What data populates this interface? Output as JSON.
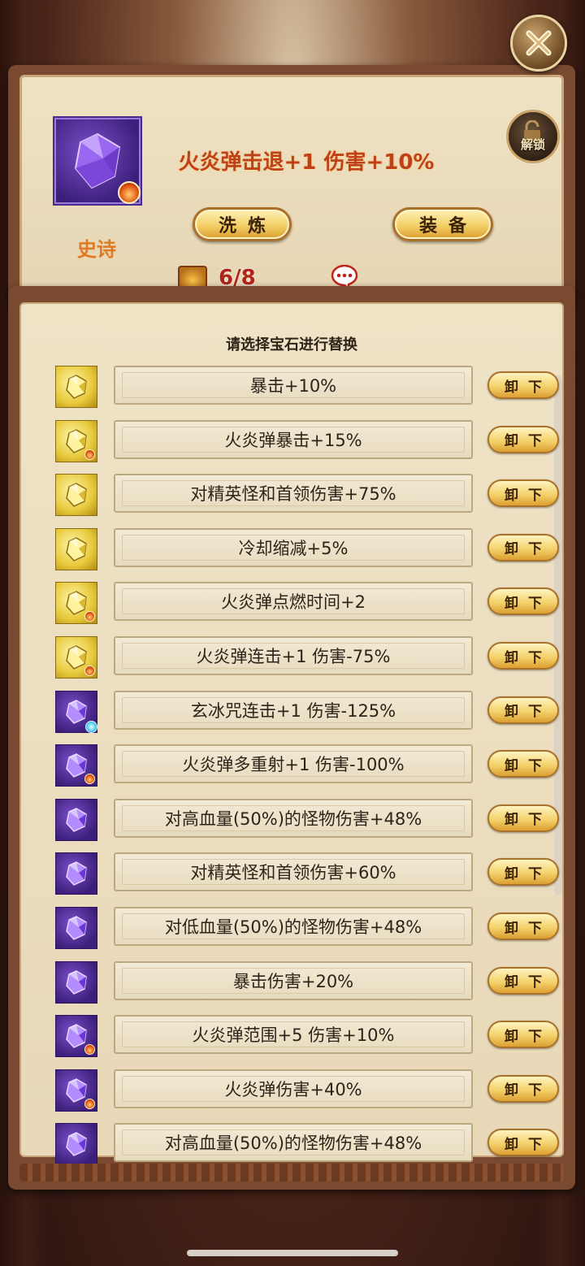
{
  "close_icon": "close-icon",
  "top_card": {
    "gem_rarity": "史诗",
    "gem_name": "火炎弹击退+1 伤害+10%",
    "unlock_label": "解锁",
    "refine_label": "洗炼",
    "equip_label": "装备",
    "count": "6/8",
    "chat_icon": "chat-bubble-icon"
  },
  "panel": {
    "instruction": "请选择宝石进行替换",
    "unload_label": "卸下",
    "rows": [
      {
        "gem": "gold",
        "badge": "",
        "text": "暴击+10%"
      },
      {
        "gem": "gold",
        "badge": "fire",
        "text": "火炎弹暴击+15%"
      },
      {
        "gem": "gold",
        "badge": "",
        "text": "对精英怪和首领伤害+75%"
      },
      {
        "gem": "gold",
        "badge": "",
        "text": "冷却缩减+5%"
      },
      {
        "gem": "gold",
        "badge": "fire",
        "text": "火炎弹点燃时间+2"
      },
      {
        "gem": "gold",
        "badge": "fire",
        "text": "火炎弹连击+1 伤害-75%"
      },
      {
        "gem": "purple",
        "badge": "ice",
        "text": "玄冰咒连击+1  伤害-125%"
      },
      {
        "gem": "purple",
        "badge": "fire",
        "text": "火炎弹多重射+1 伤害-100%"
      },
      {
        "gem": "purple",
        "badge": "",
        "text": "对高血量(50%)的怪物伤害+48%"
      },
      {
        "gem": "purple",
        "badge": "",
        "text": "对精英怪和首领伤害+60%"
      },
      {
        "gem": "purple",
        "badge": "",
        "text": "对低血量(50%)的怪物伤害+48%"
      },
      {
        "gem": "purple",
        "badge": "",
        "text": "暴击伤害+20%"
      },
      {
        "gem": "purple",
        "badge": "fire",
        "text": "火炎弹范围+5 伤害+10%"
      },
      {
        "gem": "purple",
        "badge": "fire",
        "text": "火炎弹伤害+40%"
      },
      {
        "gem": "purple",
        "badge": "",
        "text": "对高血量(50%)的怪物伤害+48%"
      }
    ]
  }
}
